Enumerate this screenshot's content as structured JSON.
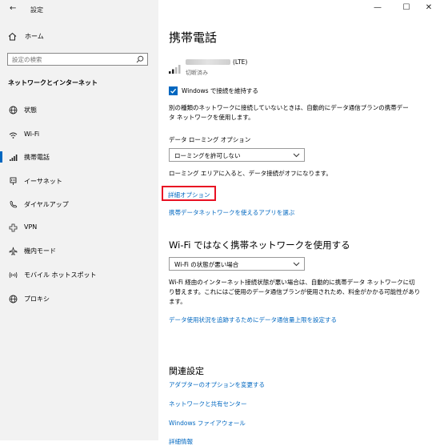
{
  "window": {
    "title": "設定",
    "back": "←",
    "minimize": "—",
    "maximize": "☐",
    "close": "✕"
  },
  "sidebar": {
    "home_label": "ホーム",
    "search_placeholder": "設定の検索",
    "section_heading": "ネットワークとインターネット",
    "items": [
      {
        "label": "状態",
        "icon": "globe-status-icon"
      },
      {
        "label": "Wi-Fi",
        "icon": "wifi-icon"
      },
      {
        "label": "携帯電話",
        "icon": "cellular-icon",
        "active": true
      },
      {
        "label": "イーサネット",
        "icon": "ethernet-icon"
      },
      {
        "label": "ダイヤルアップ",
        "icon": "dialup-icon"
      },
      {
        "label": "VPN",
        "icon": "vpn-icon"
      },
      {
        "label": "機内モード",
        "icon": "airplane-icon"
      },
      {
        "label": "モバイル ホットスポット",
        "icon": "hotspot-icon"
      },
      {
        "label": "プロキシ",
        "icon": "proxy-globe-icon"
      }
    ]
  },
  "main": {
    "title": "携帯電話",
    "network": {
      "name_suffix": "(LTE)",
      "status": "切断済み"
    },
    "keep_connected_label": "Windows で接続を維持する",
    "keep_connected_checked": true,
    "description": "別の種類のネットワークに接続していないときは、自動的にデータ通信プランの携帯データ ネットワークを使用します。",
    "roaming_label": "データ ローミング オプション",
    "roaming_value": "ローミングを許可しない",
    "roaming_note": "ローミング エリアに入ると、データ接続がオフになります。",
    "advanced_options_link": "詳細オプション",
    "apps_link": "携帯データネットワークを使えるアプリを選ぶ",
    "wifi_section_title": "Wi-Fi ではなく携帯ネットワークを使用する",
    "wifi_dropdown_value": "Wi-Fi の状態が悪い場合",
    "wifi_description": "Wi-Fi 経由のインターネット接続状態が悪い場合は、自動的に携帯データ ネットワークに切り替えます。これにはご使用のデータ通信プランが使用されため、料金がかかる可能性があります。",
    "data_limit_link": "データ使用状況を追跡するためにデータ通信量上限を設定する",
    "related_title": "関連設定",
    "related_links": [
      "アダプターのオプションを変更する",
      "ネットワークと共有センター",
      "Windows ファイアウォール",
      "詳細情報"
    ]
  }
}
